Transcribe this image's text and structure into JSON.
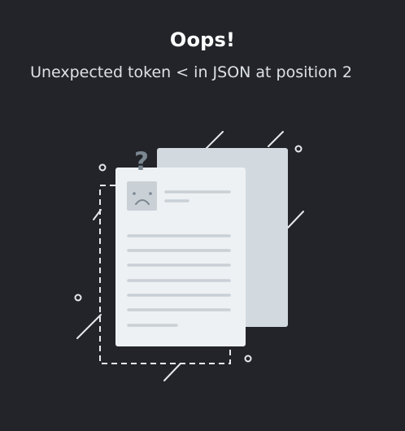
{
  "error": {
    "title": "Oops!",
    "message": "Unexpected token < in JSON at position 2"
  },
  "illustration": {
    "icon": "broken-document-icon",
    "question_mark": "?",
    "colors": {
      "background": "#222429",
      "back_page": "#d3dadf",
      "front_page": "#eef1f3",
      "lines": "#c9d0d6",
      "decor": "#e6e9ec",
      "question": "#7b8791"
    }
  }
}
